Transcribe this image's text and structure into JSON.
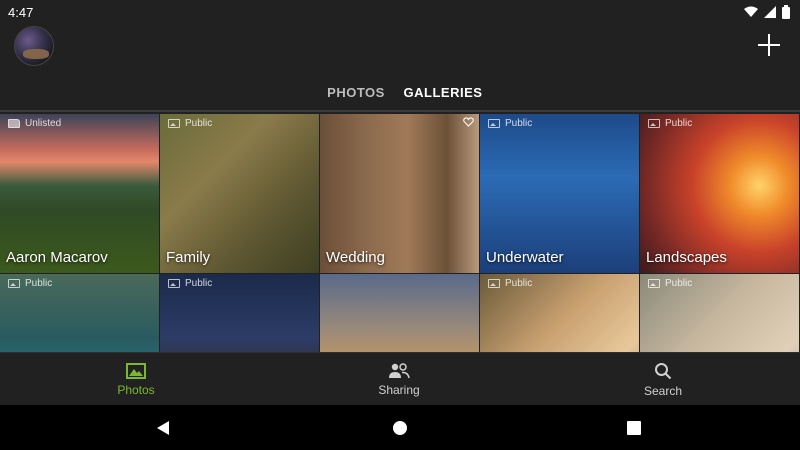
{
  "status_bar": {
    "time": "4:47"
  },
  "tabs": [
    {
      "label": "PHOTOS",
      "active": false
    },
    {
      "label": "GALLERIES",
      "active": true
    }
  ],
  "galleries": [
    {
      "title": "Aaron Macarov",
      "visibility": "Unlisted",
      "icon": "folder-icon"
    },
    {
      "title": "Family",
      "visibility": "Public",
      "icon": "gallery-icon"
    },
    {
      "title": "Wedding",
      "visibility": "",
      "icon": "heart-icon"
    },
    {
      "title": "Underwater",
      "visibility": "Public",
      "icon": "gallery-icon"
    },
    {
      "title": "Landscapes",
      "visibility": "Public",
      "icon": "gallery-icon"
    },
    {
      "title": "",
      "visibility": "Public",
      "icon": "gallery-icon"
    },
    {
      "title": "",
      "visibility": "Public",
      "icon": "gallery-icon"
    },
    {
      "title": "",
      "visibility": "",
      "icon": "gallery-icon"
    },
    {
      "title": "",
      "visibility": "Public",
      "icon": "gallery-icon"
    },
    {
      "title": "",
      "visibility": "Public",
      "icon": "gallery-icon"
    }
  ],
  "bottom_nav": [
    {
      "label": "Photos",
      "icon": "photo-icon",
      "active": true
    },
    {
      "label": "Sharing",
      "icon": "people-icon",
      "active": false
    },
    {
      "label": "Search",
      "icon": "search-icon",
      "active": false
    }
  ],
  "colors": {
    "accent": "#7cb82f",
    "background": "#212121"
  }
}
